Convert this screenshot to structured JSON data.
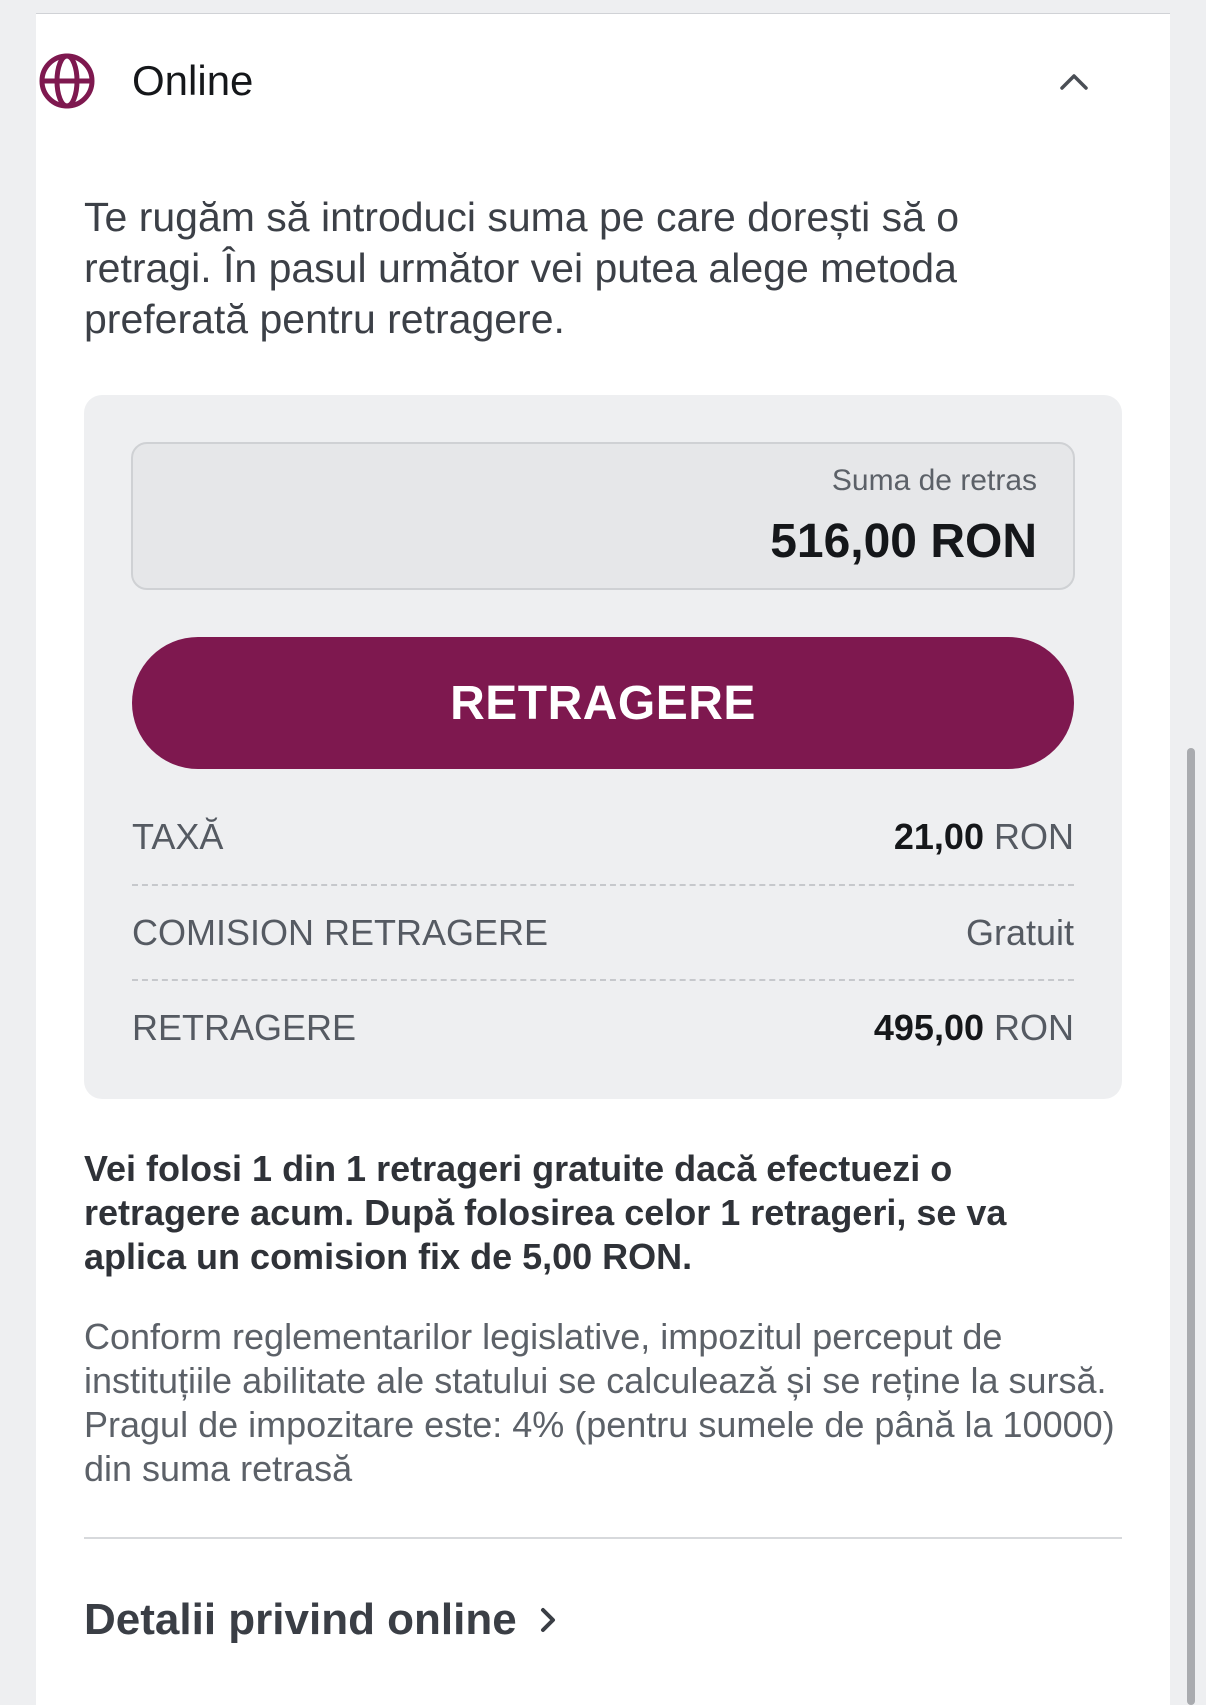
{
  "header": {
    "title": "Online",
    "icon": "globe-icon",
    "toggle_icon": "chevron-up-icon"
  },
  "intro": "Te rugăm să introduci suma pe care dorești să o retragi. În pasul următor vei putea alege metoda preferată pentru retragere.",
  "amount_field": {
    "label": "Suma de retras",
    "value": "516,00 RON"
  },
  "withdraw_button": "RETRAGERE",
  "summary": [
    {
      "label": "TAXĂ",
      "amount": "21,00",
      "unit": "RON"
    },
    {
      "label": "COMISION RETRAGERE",
      "amount": "",
      "unit": "Gratuit"
    },
    {
      "label": "RETRAGERE",
      "amount": "495,00",
      "unit": "RON"
    }
  ],
  "free_note": "Vei folosi 1 din 1 retrageri gratuite dacă efectuezi o retragere acum. După folosirea celor 1 retrageri, se va aplica un comision fix de 5,00 RON.",
  "legal_note": "Conform reglementarilor legislative, impozitul perceput de instituțiile abilitate ale statului se calculează și se reține la sursă. Pragul de impozitare este: 4% (pentru sumele de până la 10000) din suma retrasă",
  "details_link": {
    "label": "Detalii privind online",
    "icon": "chevron-right-icon"
  },
  "colors": {
    "accent": "#7e184f",
    "background": "#eeeff1",
    "panel": "#ffffff"
  }
}
